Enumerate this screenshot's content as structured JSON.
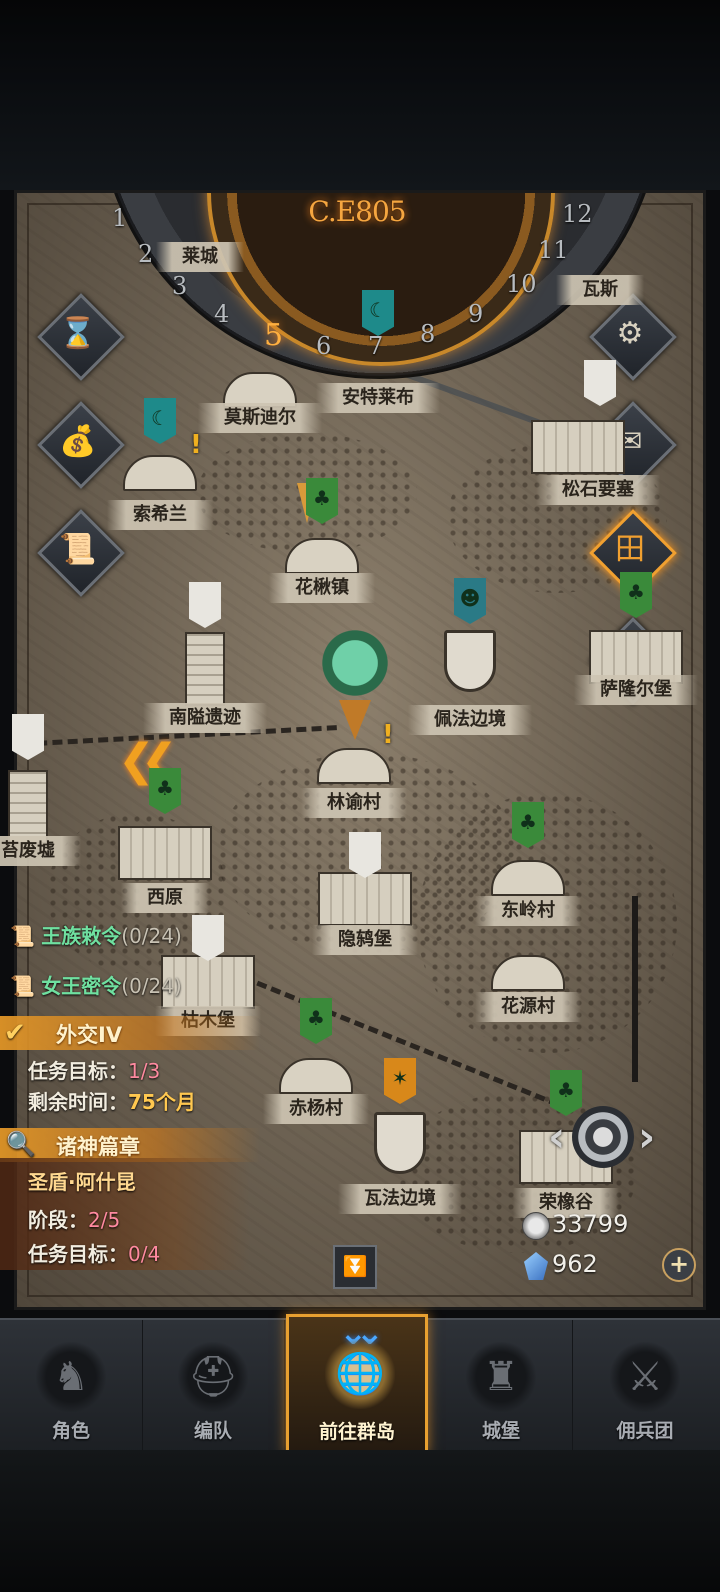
{
  "calendar": {
    "year": "C.E805",
    "months": [
      "1",
      "2",
      "3",
      "4",
      "5",
      "6",
      "7",
      "8",
      "9",
      "10",
      "11",
      "12"
    ],
    "current_month": "5"
  },
  "locations": [
    {
      "name": "莫斯迪尔",
      "building": "house"
    },
    {
      "name": "安特莱布",
      "building": "house"
    },
    {
      "name": "索希兰",
      "building": "house"
    },
    {
      "name": "松石要塞",
      "building": "castle"
    },
    {
      "name": "花楸镇",
      "building": "house"
    },
    {
      "name": "南隘遗迹",
      "building": "tower"
    },
    {
      "name": "佩法边境",
      "building": "shield"
    },
    {
      "name": "萨隆尔堡",
      "building": "castle"
    },
    {
      "name": "林谕村",
      "building": "house"
    },
    {
      "name": "苔废墟",
      "building": "tower"
    },
    {
      "name": "西原",
      "building": "castle"
    },
    {
      "name": "隐鸫堡",
      "building": "castle"
    },
    {
      "name": "东岭村",
      "building": "house"
    },
    {
      "name": "枯木堡",
      "building": "castle"
    },
    {
      "name": "花源村",
      "building": "house"
    },
    {
      "name": "赤杨村",
      "building": "house"
    },
    {
      "name": "瓦法边境",
      "building": "shield"
    },
    {
      "name": "荣橡谷",
      "building": "castle"
    },
    {
      "name": "瓦斯",
      "building": "castle"
    },
    {
      "name": "莱城",
      "building": "castle"
    }
  ],
  "quests": {
    "royal_decree": {
      "label": "王族敕令",
      "count": "(0/24)"
    },
    "queen_secret": {
      "label": "女王密令",
      "count": "(0/24)"
    },
    "diplomacy": {
      "title": "外交IV",
      "target_label": "任务目标：",
      "target_value": "1/3",
      "time_label": "剩余时间：",
      "time_value": "75个月"
    },
    "story": {
      "title": "诸神篇章",
      "hero": "圣盾·阿什昆",
      "stage_label": "阶段：",
      "stage_value": "2/5",
      "target_label": "任务目标：",
      "target_value": "0/4"
    }
  },
  "currency": {
    "silver": "33799",
    "gems": "962"
  },
  "nav": [
    {
      "label": "角色",
      "icon": "knight-icon"
    },
    {
      "label": "编队",
      "icon": "helmet-icon"
    },
    {
      "label": "前往群岛",
      "icon": "globe-icon"
    },
    {
      "label": "城堡",
      "icon": "castle-icon"
    },
    {
      "label": "佣兵团",
      "icon": "mercenary-icon"
    }
  ],
  "colors": {
    "accent": "#e8a030",
    "quest_green": "#6fe0a0",
    "progress_pink": "#ff8aa0",
    "time_orange": "#ffc850"
  }
}
